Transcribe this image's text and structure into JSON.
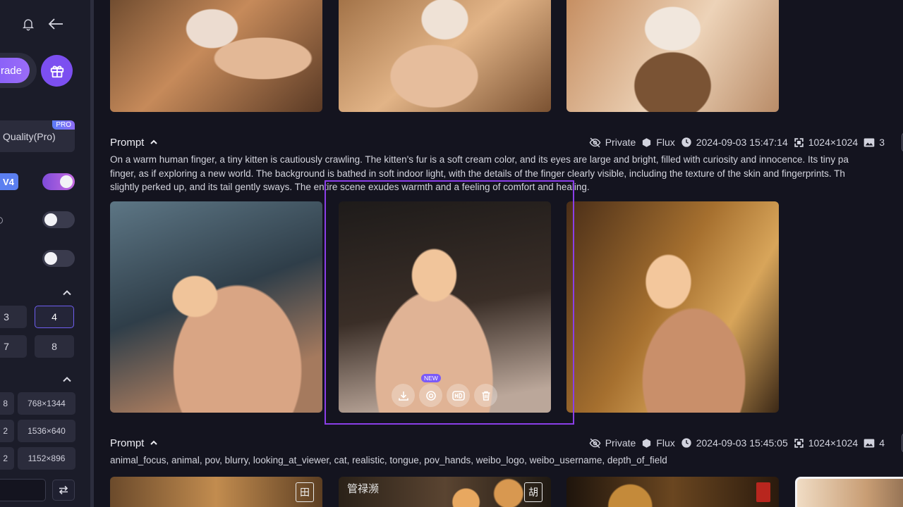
{
  "sidebar": {
    "upgrade_label": "rade",
    "quality_label": "Quality(Pro)",
    "pro_badge": "PRO",
    "version_badge": "V4",
    "toggle_1_on": true,
    "toggle_2_on": false,
    "toggle_3_on": false,
    "count_options": [
      {
        "label": "3",
        "selected": false
      },
      {
        "label": "4",
        "selected": true
      },
      {
        "label": "7",
        "selected": false
      },
      {
        "label": "8",
        "selected": false
      }
    ],
    "resolutions": [
      {
        "left": "8",
        "right": "768×1344"
      },
      {
        "left": "2",
        "right": "1536×640"
      },
      {
        "left": "2",
        "right": "1152×896"
      }
    ]
  },
  "colors": {
    "accent": "#7c4ff0",
    "selection": "#8a3ee8",
    "background": "#14141f",
    "sidebar": "#1b1c29"
  },
  "generations": [
    {
      "prompt_label": "Prompt",
      "visibility": "Private",
      "model": "Flux",
      "timestamp": "2024-09-03 15:47:14",
      "size": "1024×1024",
      "image_count": "3",
      "text_lines": [
        "On a warm human finger, a tiny kitten is cautiously crawling. The kitten's fur is a soft cream color, and its eyes are large and bright, filled with curiosity and innocence. Its tiny pa",
        "finger, as if exploring a new world. The background is bathed in soft indoor light, with the details of the finger clearly visible, including the texture of the skin and fingerprints. Th",
        "slightly perked up, and its tail gently sways. The entire scene exudes warmth and a feeling of comfort and healing."
      ]
    },
    {
      "prompt_label": "Prompt",
      "visibility": "Private",
      "model": "Flux",
      "timestamp": "2024-09-03 15:45:05",
      "size": "1024×1024",
      "image_count": "4",
      "text_lines": [
        "animal_focus, animal, pov, blurry, looking_at_viewer, cat, realistic, tongue, pov_hands, weibo_logo, weibo_username, depth_of_field"
      ]
    }
  ],
  "hover_tools": {
    "new_badge": "NEW",
    "icons": [
      "download-icon",
      "camera-icon",
      "hd-icon",
      "trash-icon"
    ]
  },
  "watermarks": {
    "one": "田",
    "two": "胡",
    "cjk_script": "管禄濒"
  }
}
